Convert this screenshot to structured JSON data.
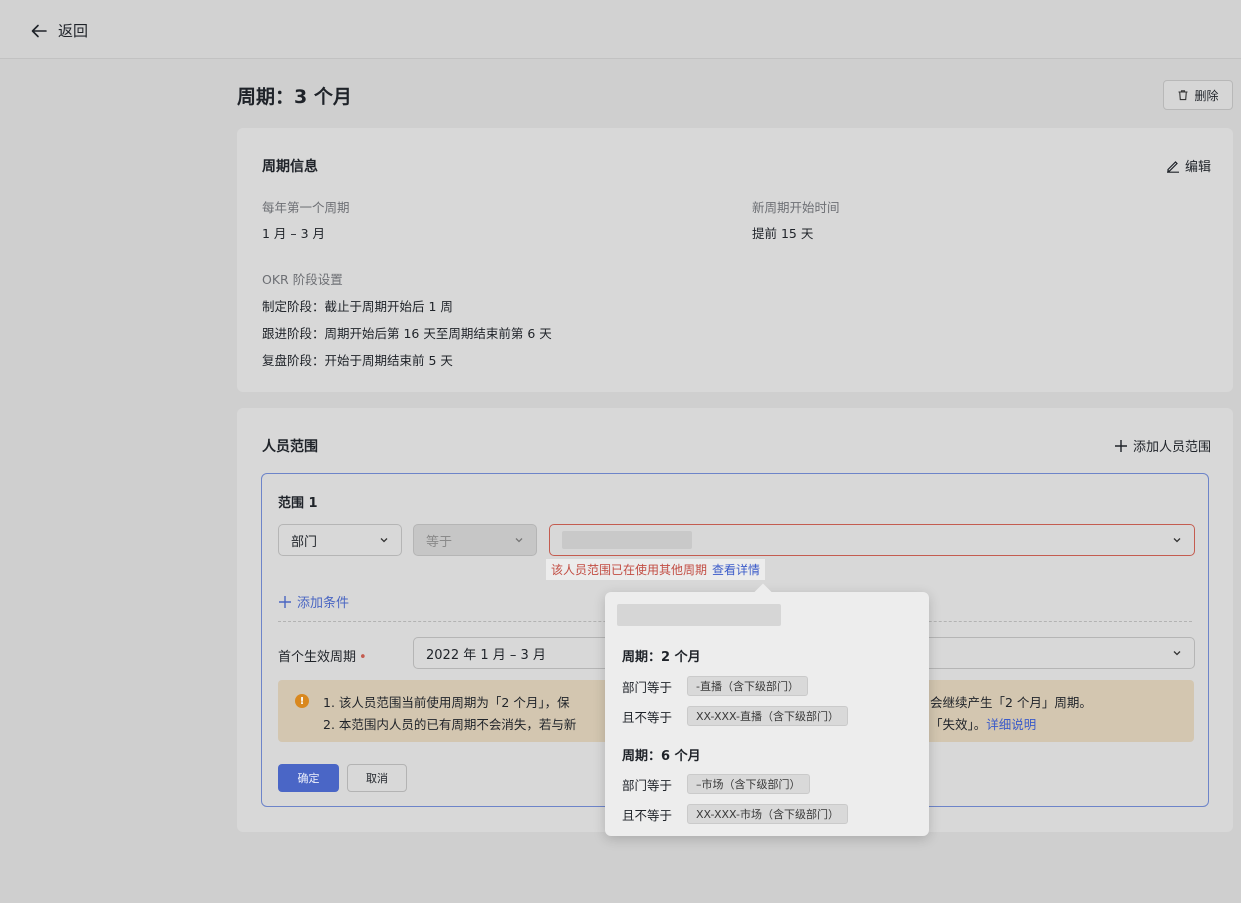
{
  "header": {
    "back_label": "返回"
  },
  "page": {
    "title": "周期：3 个月",
    "delete_label": "删除"
  },
  "cycle_info": {
    "title": "周期信息",
    "edit_label": "编辑",
    "first_cycle_label": "每年第一个周期",
    "first_cycle_value": "1 月 – 3 月",
    "new_cycle_label": "新周期开始时间",
    "new_cycle_value": "提前 15 天",
    "okr_label": "OKR 阶段设置",
    "stages": [
      "制定阶段：截止于周期开始后 1 周",
      "跟进阶段：周期开始后第 16 天至周期结束前第 6 天",
      "复盘阶段：开始于周期结束前 5 天"
    ]
  },
  "scope": {
    "title": "人员范围",
    "add_label": "添加人员范围",
    "range_title": "范围 1",
    "field_select": "部门",
    "operator_select": "等于",
    "error_text": "该人员范围已在使用其他周期",
    "error_link": "查看详情",
    "add_condition": "添加条件",
    "first_cycle_label": "首个生效周期",
    "first_cycle_value": "2022 年 1 月 – 3 月",
    "warning_line1_a": "1. 该人员范围当前使用周期为「2 个月」，保",
    "warning_line1_b": "会继续产生「2 个月」周期。",
    "warning_line2_a": "2. 本范围内人员的已有周期不会消失，若与新",
    "warning_line2_b": "「失效」。",
    "warning_link": "详细说明",
    "confirm_label": "确定",
    "cancel_label": "取消"
  },
  "popover": {
    "groups": [
      {
        "title": "周期：2 个月",
        "rows": [
          {
            "label": "部门等于",
            "tag": "-直播（含下级部门）"
          },
          {
            "label": "且不等于",
            "tag": "XX-XXX-直播（含下级部门）"
          }
        ]
      },
      {
        "title": "周期：6 个月",
        "rows": [
          {
            "label": "部门等于",
            "tag": "–市场（含下级部门）"
          },
          {
            "label": "且不等于",
            "tag": "XX-XXX-市场（含下级部门）"
          }
        ]
      }
    ]
  },
  "colors": {
    "accent": "#4a66c6",
    "error": "#c45c50",
    "warning_bg": "#d3c6b0"
  }
}
